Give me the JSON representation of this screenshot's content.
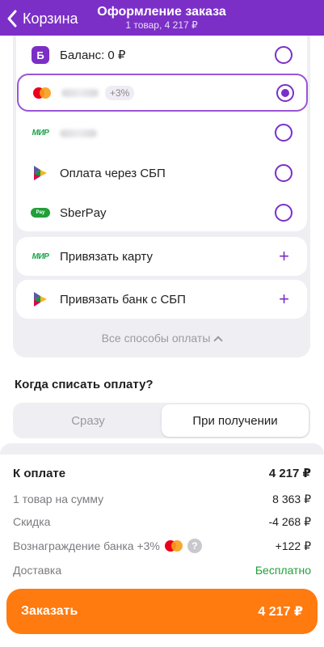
{
  "header": {
    "back_label": "Корзина",
    "title": "Оформление заказа",
    "subtitle": "1 товар, 4 217 ₽"
  },
  "payment": {
    "balance_label": "Баланс: 0 ₽",
    "bank_logo_letter": "Б",
    "card1_masked": "•• 3238",
    "card1_badge": "+3%",
    "card2_masked": "•• 1245",
    "mir_label": "МИР",
    "sbp_label": "Оплата через СБП",
    "sberpay_label": "SberPay",
    "sberpay_icon_text": "Pay",
    "link_card_label": "Привязать карту",
    "link_bank_label": "Привязать банк с СБП",
    "all_methods_label": "Все способы оплаты",
    "selected_index": 1
  },
  "when": {
    "title": "Когда списать оплату?",
    "option_now": "Сразу",
    "option_on_receipt": "При получении",
    "selected": "on_receipt"
  },
  "summary": {
    "total_label": "К оплате",
    "total_value": "4 217 ₽",
    "items_label": "1 товар на сумму",
    "items_value": "8 363 ₽",
    "discount_label": "Скидка",
    "discount_value": "-4 268 ₽",
    "reward_label": "Вознаграждение банка +3%",
    "reward_value": "+122 ₽",
    "delivery_label": "Доставка",
    "delivery_value": "Бесплатно"
  },
  "order_button": {
    "label": "Заказать",
    "amount": "4 217 ₽"
  },
  "colors": {
    "accent": "#7b2fc7",
    "button": "#ff7a0f",
    "free": "#21a038"
  }
}
